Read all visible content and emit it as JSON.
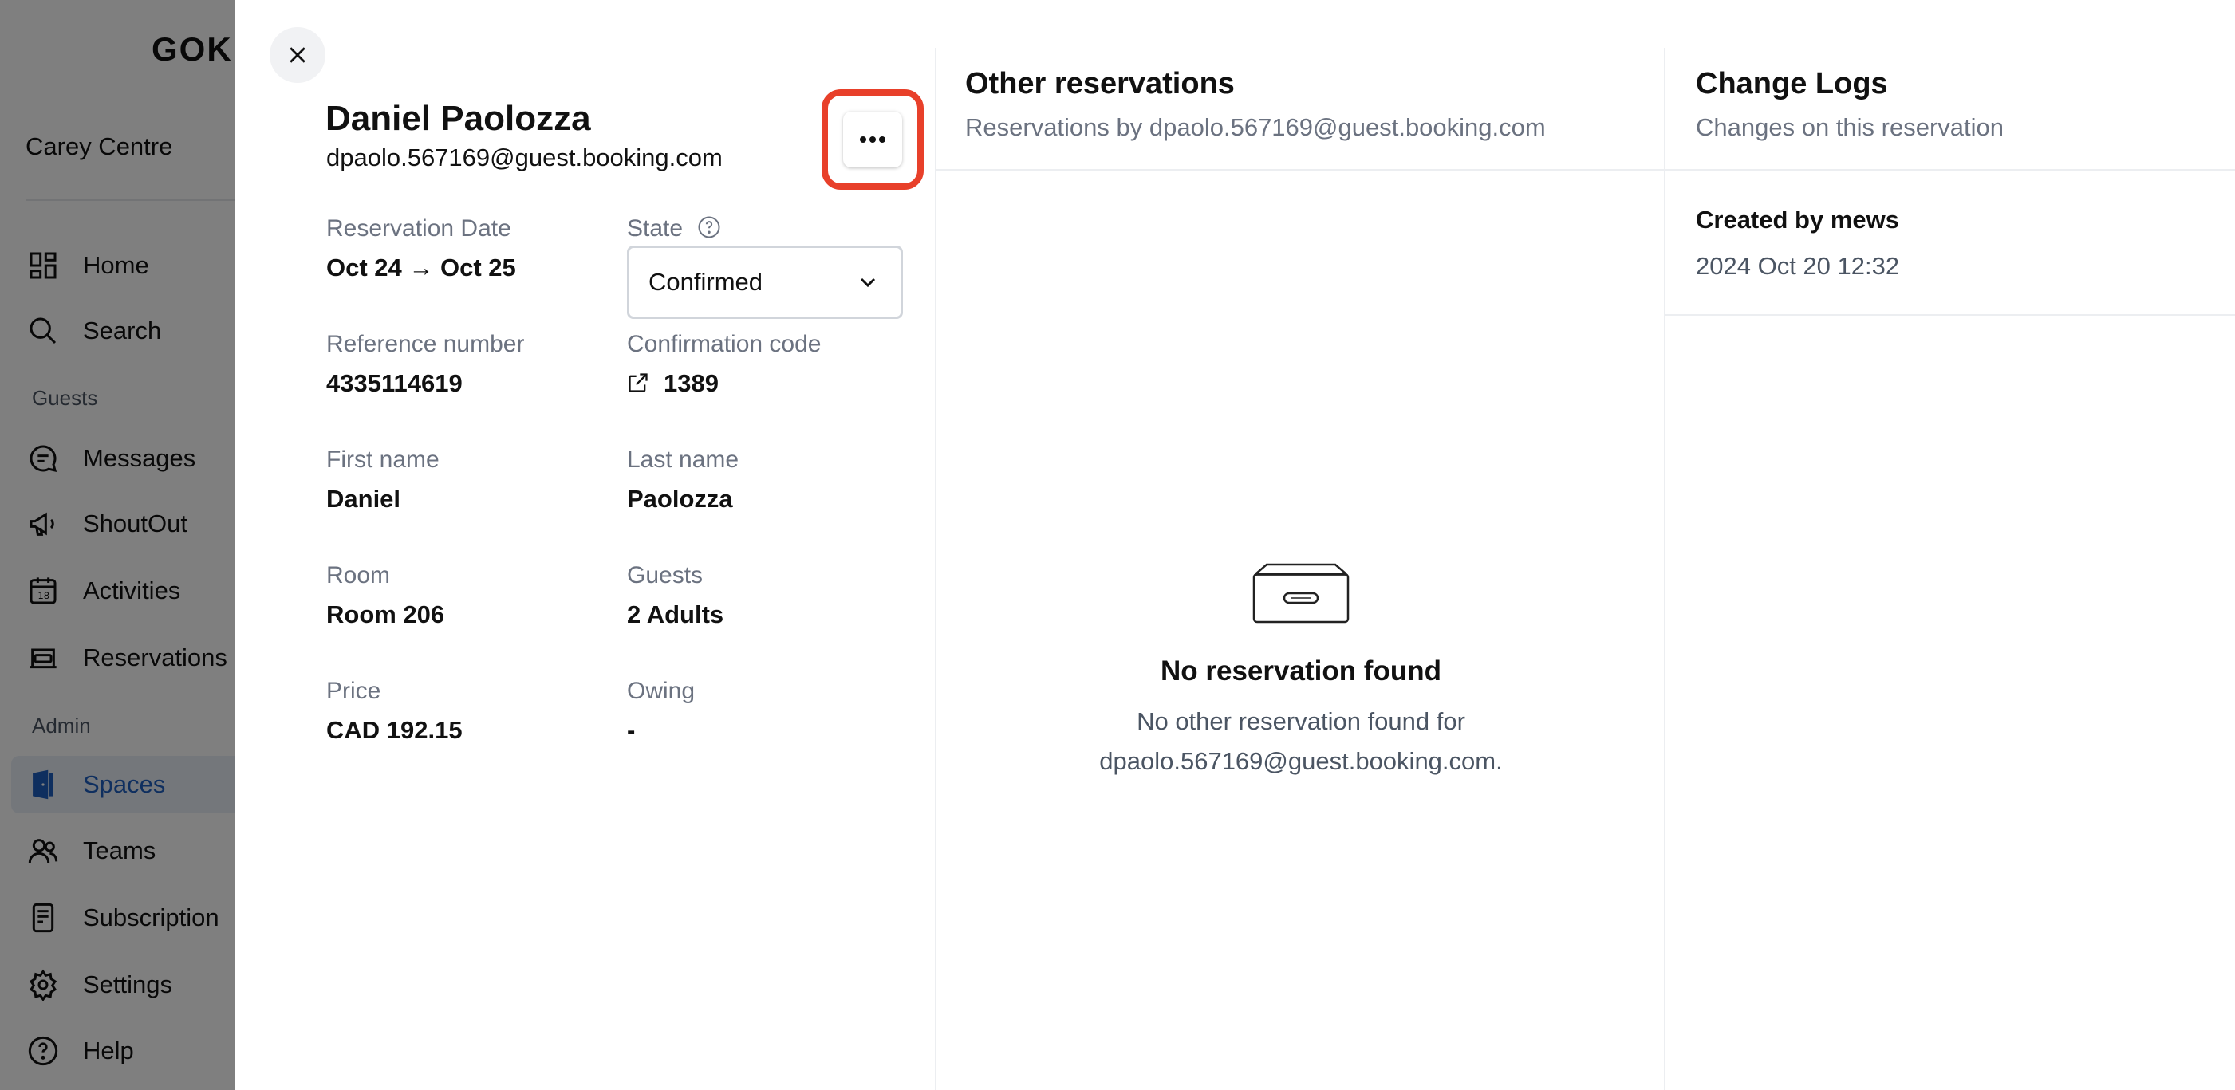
{
  "sidebar": {
    "logo": "GOK",
    "property": "Carey Centre",
    "sections": {
      "guests": "Guests",
      "admin": "Admin"
    },
    "items": [
      {
        "label": "Home",
        "icon": "dashboard-icon"
      },
      {
        "label": "Search",
        "icon": "search-icon"
      },
      {
        "label": "Messages",
        "icon": "chat-icon"
      },
      {
        "label": "ShoutOut",
        "icon": "megaphone-icon"
      },
      {
        "label": "Activities",
        "icon": "calendar-icon"
      },
      {
        "label": "Reservations",
        "icon": "bed-icon"
      },
      {
        "label": "Spaces",
        "icon": "door-icon",
        "active": true
      },
      {
        "label": "Teams",
        "icon": "users-icon"
      },
      {
        "label": "Subscription",
        "icon": "receipt-icon"
      },
      {
        "label": "Settings",
        "icon": "gear-icon"
      },
      {
        "label": "Help",
        "icon": "help-icon"
      }
    ]
  },
  "drawer": {
    "guest": {
      "name": "Daniel Paolozza",
      "email": "dpaolo.567169@guest.booking.com"
    },
    "fields": {
      "reservation_date_label": "Reservation Date",
      "reservation_date_value": "Oct 24 → Oct 25",
      "state_label": "State",
      "state_value": "Confirmed",
      "reference_label": "Reference number",
      "reference_value": "4335114619",
      "confirmation_label": "Confirmation code",
      "confirmation_value": "1389",
      "first_name_label": "First name",
      "first_name_value": "Daniel",
      "last_name_label": "Last name",
      "last_name_value": "Paolozza",
      "room_label": "Room",
      "room_value": "Room 206",
      "guests_label": "Guests",
      "guests_value": "2 Adults",
      "price_label": "Price",
      "price_value": "CAD 192.15",
      "owing_label": "Owing",
      "owing_value": "-"
    },
    "other_reservations": {
      "title": "Other reservations",
      "subtitle": "Reservations by dpaolo.567169@guest.booking.com",
      "empty_title": "No reservation found",
      "empty_desc_line1": "No other reservation found for",
      "empty_desc_line2": "dpaolo.567169@guest.booking.com."
    },
    "change_logs": {
      "title": "Change Logs",
      "subtitle": "Changes on this reservation",
      "entries": [
        {
          "title": "Created by mews",
          "time": "2024 Oct 20 12:32"
        }
      ]
    }
  },
  "colors": {
    "highlight": "#e8402a",
    "active_nav": "#1f5fbf",
    "muted_text": "#6b7280"
  }
}
